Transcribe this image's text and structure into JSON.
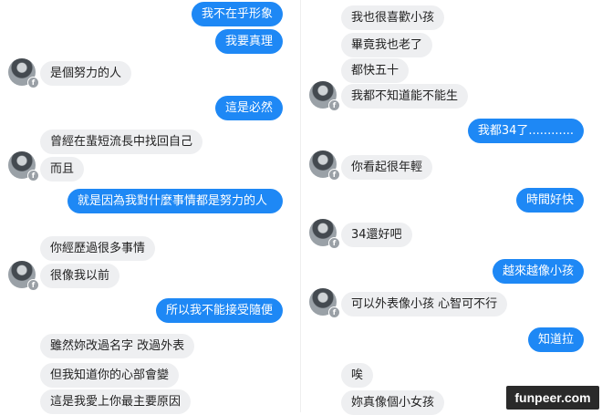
{
  "left_column": {
    "messages": [
      {
        "side": "out",
        "text": "我不在乎形象"
      },
      {
        "side": "out",
        "text": "我要真理"
      },
      {
        "side": "in",
        "text": "是個努力的人"
      },
      {
        "side": "out",
        "text": "這是必然"
      },
      {
        "side": "in",
        "text": "曾經在蜚短流長中找回自己"
      },
      {
        "side": "in",
        "text": "而且"
      },
      {
        "side": "out",
        "text": "就是因為我對什麼事情都是努力的人"
      },
      {
        "side": "in",
        "text": "你經歷過很多事情"
      },
      {
        "side": "in",
        "text": "很像我以前"
      },
      {
        "side": "out",
        "text": "所以我不能接受隨便"
      },
      {
        "side": "in",
        "text": "雖然妳改過名字 改過外表"
      },
      {
        "side": "in",
        "text": "但我知道你的心部會變"
      },
      {
        "side": "in",
        "text": "這是我愛上你最主要原因"
      }
    ]
  },
  "right_column": {
    "messages": [
      {
        "side": "in",
        "text": "我也很喜歡小孩"
      },
      {
        "side": "in",
        "text": "畢竟我也老了"
      },
      {
        "side": "in",
        "text": "都快五十"
      },
      {
        "side": "in",
        "text": "我都不知道能不能生"
      },
      {
        "side": "out",
        "text": "我都34了............"
      },
      {
        "side": "in",
        "text": "你看起很年輕"
      },
      {
        "side": "out",
        "text": "時間好快"
      },
      {
        "side": "in",
        "text": "34還好吧"
      },
      {
        "side": "out",
        "text": "越來越像小孩"
      },
      {
        "side": "in",
        "text": "可以外表像小孩  心智可不行"
      },
      {
        "side": "out",
        "text": "知道拉"
      },
      {
        "side": "in",
        "text": "唉"
      },
      {
        "side": "in",
        "text": "妳真像個小女孩"
      }
    ]
  },
  "avatar": {
    "icon": "user-avatar-icon",
    "badge_icon": "messenger-badge-icon",
    "badge_glyph": "f"
  },
  "watermark": {
    "text": "funpeer.com"
  },
  "colors": {
    "outgoing_bubble": "#1e88f5",
    "incoming_bubble": "#eeeff1",
    "background": "#ffffff"
  }
}
